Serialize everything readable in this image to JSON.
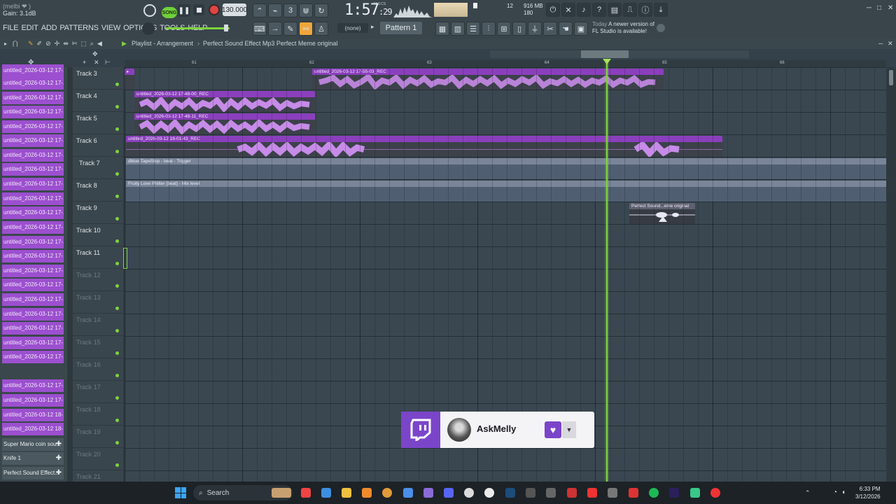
{
  "app": {
    "hint_line1": "(melbi ❤ )",
    "hint_line2": "Gain: 3.1dB",
    "menu": [
      "FILE",
      "EDIT",
      "ADD",
      "PATTERNS",
      "VIEW",
      "OPTIONS",
      "TOOLS",
      "HELP"
    ],
    "song_label": "SONG",
    "tempo": "130.000",
    "time_main": "1:57",
    "time_sub": ":29",
    "time_unit": "M:S:CS",
    "poly": "12",
    "memory": "916 MB",
    "cpu_val": "180",
    "pattern": "Pattern 1",
    "snap": "(none)",
    "news_line1": "Today",
    "news_line2": "A newer version of",
    "news_line3": "FL Studio is available!"
  },
  "playlist": {
    "title": "Playlist - Arrangement",
    "breadcrumb": "Perfect Sound Effect Mp3 Perfect Meme original",
    "ruler": [
      "61",
      "62",
      "63",
      "64",
      "65",
      "66"
    ]
  },
  "browser": {
    "items": [
      "untitled_2026-03-12 17-...",
      "untitled_2026-03-12 17-...",
      "untitled_2026-03-12 17-...",
      "untitled_2026-03-12 17-...",
      "untitled_2026-03-12 17-...",
      "untitled_2026-03-12 17-...",
      "untitled_2026-03-12 17-...",
      "untitled_2026-03-12 17-...",
      "untitled_2026-03-12 17-...",
      "untitled_2026-03-12 17-...",
      "untitled_2026-03-12 17-...",
      "untitled_2026-03-12 17-...",
      "untitled_2026-03-12 17-...",
      "untitled_2026-03-12 17-...",
      "untitled_2026-03-12 17-...",
      "untitled_2026-03-12 17-...",
      "untitled_2026-03-12 17-...",
      "untitled_2026-03-12 17-...",
      "untitled_2026-03-12 17-...",
      "untitled_2026-03-12 17-...",
      "untitled_2026-03-12 17-...",
      "untitled_2026-03-12 17-...",
      "untitled_2026-03-12 17-...",
      "untitled_2026-03-12 18-...",
      "untitled_2026-03-12 18-..."
    ],
    "extras": [
      "Super Mario coin sou...",
      "Knife 1",
      "Perfect Sound Effect..."
    ]
  },
  "tracks": [
    "Track 3",
    "Track 4",
    "Track 5",
    "Track 6",
    "Track 7",
    "Track 8",
    "Track 9",
    "Track 10",
    "Track 11",
    "Track 12",
    "Track 13",
    "Track 14",
    "Track 15",
    "Track 16",
    "Track 17",
    "Track 18",
    "Track 19",
    "Track 20",
    "Track 21"
  ],
  "clips": {
    "t3": "untitled_2026-03-12 17-55-03_REC",
    "t4": "untitled_2026-03-12 17-48-00_REC",
    "t5": "untitled_2026-03-12 17-48-11_REC",
    "t6": "untitled_2026-03-12 18-01-43_REC",
    "t7": "dblue.TapeStop - beat - Trigger",
    "t8": "Fruity Love Philter (beat) - Mix level",
    "t9": "Perfect Sound...eme original"
  },
  "twitch": {
    "username": "AskMelly"
  },
  "taskbar": {
    "search_placeholder": "Search",
    "time": "6:33 PM",
    "date": "3/12/2026"
  },
  "colors": {
    "clip": "#9c4fcf",
    "playhead": "#7fd23f",
    "automation": "#7a8599",
    "twitch": "#7b45c9"
  }
}
